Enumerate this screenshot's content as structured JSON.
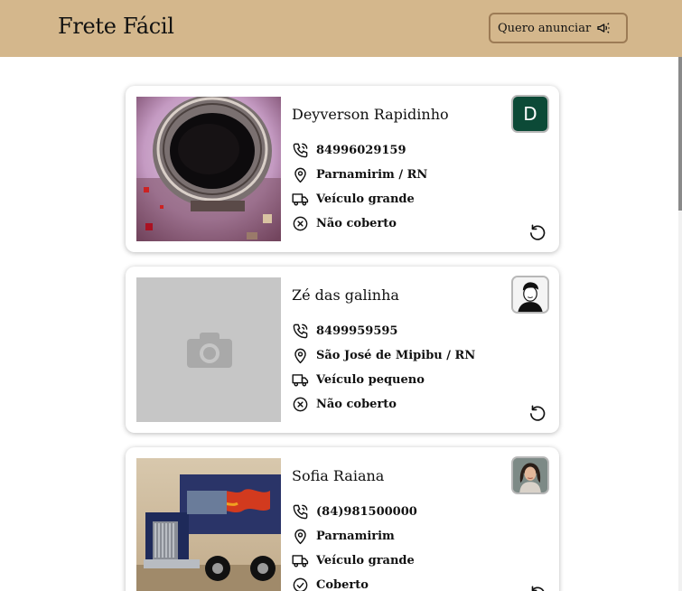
{
  "header": {
    "brand": "Frete Fácil",
    "advertise_label": "Quero anunciar",
    "advertise_icon": "megaphone-icon"
  },
  "colors": {
    "header_bg": "#d4b78c",
    "avatar_letter_bg": "#0c4a37"
  },
  "cards": [
    {
      "name": "Deyverson Rapidinho",
      "avatar_letter": "D",
      "phone": "84996029159",
      "location": "Parnamirim / RN",
      "vehicle": "Veículo grande",
      "coverage": "Não coberto",
      "photo": "astronaut-helmet-image"
    },
    {
      "name": "Zé das galinha",
      "phone": "8499959595",
      "location": "São José de Mipibu / RN",
      "vehicle": "Veículo pequeno",
      "coverage": "Não coberto",
      "photo": "camera-placeholder-icon"
    },
    {
      "name": "Sofia Raiana",
      "phone": "(84)981500000",
      "location": "Parnamirim",
      "vehicle": "Veículo grande",
      "coverage": "Coberto",
      "photo": "truck-image"
    }
  ]
}
